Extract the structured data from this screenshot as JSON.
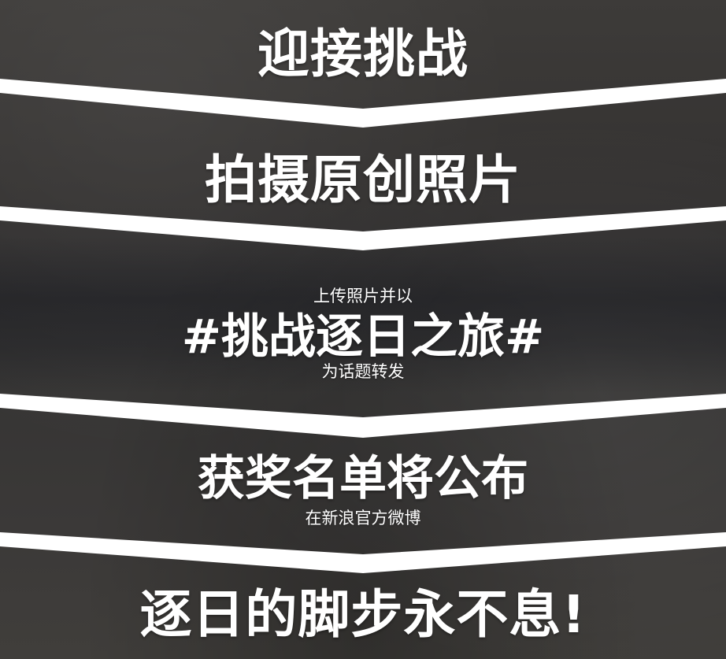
{
  "steps": [
    {
      "title": "迎接挑战"
    },
    {
      "title": "拍摄原创照片"
    },
    {
      "pre": "上传照片并以",
      "title": "#挑战逐日之旅#",
      "post": "为话题转发"
    },
    {
      "title": "获奖名单将公布",
      "post": "在新浪官方微博"
    },
    {
      "title": "逐日的脚步永不息!"
    }
  ],
  "colors": {
    "text": "#ffffff",
    "chevron": "#ffffff",
    "background": "#3a3836"
  }
}
